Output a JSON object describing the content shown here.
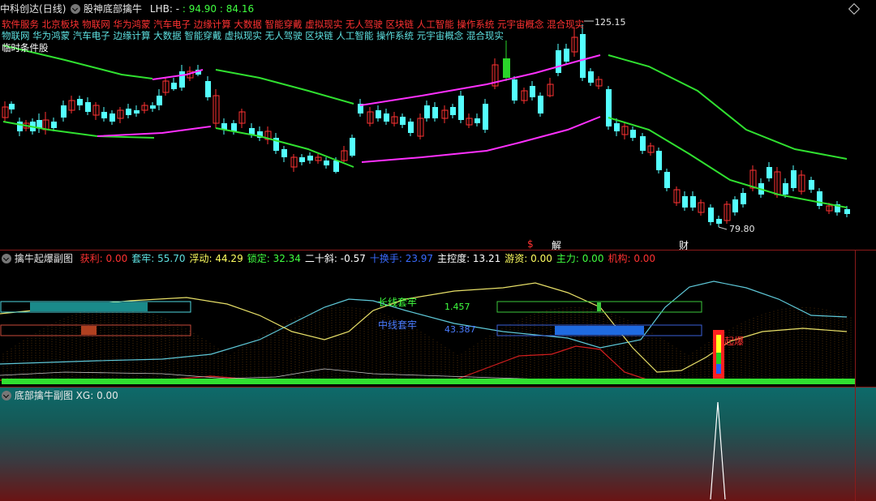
{
  "main": {
    "stock_name": "中科创达",
    "period": "(日线)",
    "indicator_name": "股神底部擒牛",
    "lhb_label": "LHB: -",
    "lhb_v1": ": 94.90",
    "lhb_v2": ": 84.16",
    "concepts_line1": "软件服务 北京板块 物联网 华为鸿蒙 汽车电子 边缘计算 大数据 智能穿戴 虚拟现实 无人驾驶 区块链 人工智能 操作系统 元宇宙概念 混合现实",
    "concepts_line2": "物联网 华为鸿蒙 汽车电子 边缘计算 大数据 智能穿戴 虚拟现实 无人驾驶 区块链 人工智能 操作系统 元宇宙概念 混合现实",
    "condition_label": "临时条件股",
    "high_price": "125.15",
    "low_price": "79.80",
    "marker_s": "$",
    "marker_jie": "解",
    "marker_cai": "财",
    "colors": {
      "up": "#ff3232",
      "down": "#54ffff",
      "band_green": "#30e030",
      "band_magenta": "#ff30ff"
    }
  },
  "sub1": {
    "title": "擒牛起爆副图",
    "fields": [
      {
        "label": "获利:",
        "value": "0.00",
        "color": "red"
      },
      {
        "label": "套牢:",
        "value": "55.70",
        "color": "cyan"
      },
      {
        "label": "浮动:",
        "value": "44.29",
        "color": "yellow"
      },
      {
        "label": "锁定:",
        "value": "32.34",
        "color": "green"
      },
      {
        "label": "二十斜:",
        "value": "-0.57",
        "color": "white"
      },
      {
        "label": "十换手:",
        "value": "23.97",
        "color": "blue"
      },
      {
        "label": "主控度:",
        "value": "13.21",
        "color": "white"
      },
      {
        "label": "游资:",
        "value": "0.00",
        "color": "yellow"
      },
      {
        "label": "主力:",
        "value": "0.00",
        "color": "green"
      },
      {
        "label": "机构:",
        "value": "0.00",
        "color": "red"
      }
    ],
    "long_lock_label": "长线套牢",
    "long_lock_value": "1.457",
    "mid_lock_label": "中线套牢",
    "mid_lock_value": "43.387",
    "burst_label": "起爆"
  },
  "sub2": {
    "title": "底部擒牛副图",
    "xg_label": "XG:",
    "xg_value": "0.00"
  }
}
